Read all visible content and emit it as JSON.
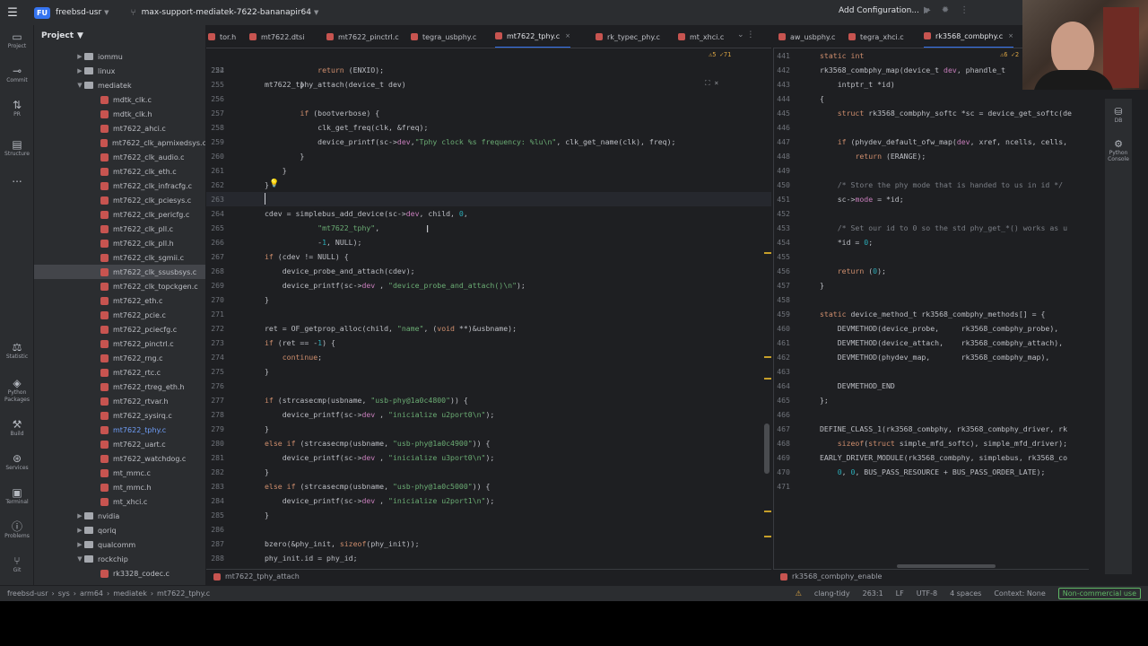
{
  "topbar": {
    "project_badge": "FU",
    "project_name": "freebsd-usr",
    "branch": "max-support-mediatek-7622-bananapir64",
    "run_config": "Add Configuration..."
  },
  "leftstrip": {
    "project": "Project",
    "commit": "Commit",
    "pr": "PR",
    "structure": "Structure",
    "more": "...",
    "statistic": "Statistic",
    "python_packages": "Python Packages",
    "build": "Build",
    "services": "Services",
    "terminal": "Terminal",
    "problems": "Problems",
    "git": "Git"
  },
  "project_panel": {
    "title": "Project",
    "rows": [
      {
        "label": "iommu",
        "type": "folder",
        "level": 1,
        "collapsed": true
      },
      {
        "label": "linux",
        "type": "folder",
        "level": 1,
        "collapsed": true
      },
      {
        "label": "mediatek",
        "type": "folder",
        "level": 1,
        "collapsed": false
      },
      {
        "label": "mdtk_clk.c",
        "type": "file",
        "level": 2
      },
      {
        "label": "mdtk_clk.h",
        "type": "file",
        "level": 2
      },
      {
        "label": "mt7622_ahci.c",
        "type": "file",
        "level": 2
      },
      {
        "label": "mt7622_clk_apmixedsys.c",
        "type": "file",
        "level": 2
      },
      {
        "label": "mt7622_clk_audio.c",
        "type": "file",
        "level": 2
      },
      {
        "label": "mt7622_clk_eth.c",
        "type": "file",
        "level": 2
      },
      {
        "label": "mt7622_clk_infracfg.c",
        "type": "file",
        "level": 2
      },
      {
        "label": "mt7622_clk_pciesys.c",
        "type": "file",
        "level": 2
      },
      {
        "label": "mt7622_clk_pericfg.c",
        "type": "file",
        "level": 2
      },
      {
        "label": "mt7622_clk_pll.c",
        "type": "file",
        "level": 2
      },
      {
        "label": "mt7622_clk_pll.h",
        "type": "file",
        "level": 2
      },
      {
        "label": "mt7622_clk_sgmii.c",
        "type": "file",
        "level": 2
      },
      {
        "label": "mt7622_clk_ssusbsys.c",
        "type": "file",
        "level": 2,
        "selected": true
      },
      {
        "label": "mt7622_clk_topckgen.c",
        "type": "file",
        "level": 2
      },
      {
        "label": "mt7622_eth.c",
        "type": "file",
        "level": 2
      },
      {
        "label": "mt7622_pcie.c",
        "type": "file",
        "level": 2
      },
      {
        "label": "mt7622_pciecfg.c",
        "type": "file",
        "level": 2
      },
      {
        "label": "mt7622_pinctrl.c",
        "type": "file",
        "level": 2
      },
      {
        "label": "mt7622_rng.c",
        "type": "file",
        "level": 2
      },
      {
        "label": "mt7622_rtc.c",
        "type": "file",
        "level": 2
      },
      {
        "label": "mt7622_rtreg_eth.h",
        "type": "file",
        "level": 2
      },
      {
        "label": "mt7622_rtvar.h",
        "type": "file",
        "level": 2
      },
      {
        "label": "mt7622_sysirq.c",
        "type": "file",
        "level": 2
      },
      {
        "label": "mt7622_tphy.c",
        "type": "file",
        "level": 2,
        "modified": true
      },
      {
        "label": "mt7622_uart.c",
        "type": "file",
        "level": 2
      },
      {
        "label": "mt7622_watchdog.c",
        "type": "file",
        "level": 2
      },
      {
        "label": "mt_mmc.c",
        "type": "file",
        "level": 2
      },
      {
        "label": "mt_mmc.h",
        "type": "file",
        "level": 2
      },
      {
        "label": "mt_xhci.c",
        "type": "file",
        "level": 2
      },
      {
        "label": "nvidia",
        "type": "folder",
        "level": 1,
        "collapsed": true
      },
      {
        "label": "qoriq",
        "type": "folder",
        "level": 1,
        "collapsed": true
      },
      {
        "label": "qualcomm",
        "type": "folder",
        "level": 1,
        "collapsed": true
      },
      {
        "label": "rockchip",
        "type": "folder",
        "level": 1,
        "collapsed": false
      },
      {
        "label": "rk3328_codec.c",
        "type": "file",
        "level": 2
      }
    ]
  },
  "tabs_left": [
    {
      "label": "tor.h",
      "active": false
    },
    {
      "label": "mt7622.dtsi",
      "active": false
    },
    {
      "label": "mt7622_pinctrl.c",
      "active": false
    },
    {
      "label": "tegra_usbphy.c",
      "active": false
    },
    {
      "label": "mt7622_tphy.c",
      "active": true
    },
    {
      "label": "rk_typec_phy.c",
      "active": false
    },
    {
      "label": "mt_xhci.c",
      "active": false
    }
  ],
  "tabs_right": [
    {
      "label": "aw_usbphy.c",
      "active": false
    },
    {
      "label": "tegra_xhci.c",
      "active": false
    },
    {
      "label": "rk3568_combphy.c",
      "active": true
    }
  ],
  "editor_left": {
    "sticky": "mt7622_tphy_attach(device_t dev)",
    "inspection": "⚠5  ✓71",
    "lines": [
      {
        "n": "254",
        "code": "\t\t\treturn (ENXIO);"
      },
      {
        "n": "255",
        "code": "\t\t}"
      },
      {
        "n": "256",
        "code": ""
      },
      {
        "n": "257",
        "code": "\t\tif (bootverbose) {"
      },
      {
        "n": "258",
        "code": "\t\t\tclk_get_freq(clk, &freq);"
      },
      {
        "n": "259",
        "code": "\t\t\tdevice_printf(sc->dev,\"Tphy clock %s frequency: %lu\\n\", clk_get_name(clk), freq);"
      },
      {
        "n": "260",
        "code": "\t\t}"
      },
      {
        "n": "261",
        "code": "\t}"
      },
      {
        "n": "262",
        "code": "}"
      },
      {
        "n": "263",
        "code": ""
      },
      {
        "n": "264",
        "code": "cdev = simplebus_add_device(sc->dev, child, 0,"
      },
      {
        "n": "265",
        "code": "\t\t\t\"mt7622_tphy\","
      },
      {
        "n": "266",
        "code": "\t\t\t-1, NULL);"
      },
      {
        "n": "267",
        "code": "if (cdev != NULL) {"
      },
      {
        "n": "268",
        "code": "\tdevice_probe_and_attach(cdev);"
      },
      {
        "n": "269",
        "code": "\tdevice_printf(sc->dev , \"device_probe_and_attach()\\n\");"
      },
      {
        "n": "270",
        "code": "}"
      },
      {
        "n": "271",
        "code": ""
      },
      {
        "n": "272",
        "code": "ret = OF_getprop_alloc(child, \"name\", (void **)&usbname);"
      },
      {
        "n": "273",
        "code": "if (ret == -1) {"
      },
      {
        "n": "274",
        "code": "\tcontinue;"
      },
      {
        "n": "275",
        "code": "}"
      },
      {
        "n": "276",
        "code": ""
      },
      {
        "n": "277",
        "code": "if (strcasecmp(usbname, \"usb-phy@1a0c4800\")) {"
      },
      {
        "n": "278",
        "code": "\tdevice_printf(sc->dev , \"inicialize u2port0\\n\");"
      },
      {
        "n": "279",
        "code": "}"
      },
      {
        "n": "280",
        "code": "else if (strcasecmp(usbname, \"usb-phy@1a0c4900\")) {"
      },
      {
        "n": "281",
        "code": "\tdevice_printf(sc->dev , \"inicialize u3port0\\n\");"
      },
      {
        "n": "282",
        "code": "}"
      },
      {
        "n": "283",
        "code": "else if (strcasecmp(usbname, \"usb-phy@1a0c5000\")) {"
      },
      {
        "n": "284",
        "code": "\tdevice_printf(sc->dev , \"inicialize u2port1\\n\");"
      },
      {
        "n": "285",
        "code": "}"
      },
      {
        "n": "286",
        "code": ""
      },
      {
        "n": "287",
        "code": "bzero(&phy_init, sizeof(phy_init));"
      },
      {
        "n": "288",
        "code": "phy_init.id = phy_id;"
      }
    ],
    "status_fn": "mt7622_tphy_attach"
  },
  "editor_right": {
    "inspection": "⚠6  ✓2",
    "lines": [
      {
        "n": "441",
        "code": "static int"
      },
      {
        "n": "442",
        "code": "rk3568_combphy_map(device_t dev, phandle_t"
      },
      {
        "n": "443",
        "code": "    intptr_t *id)"
      },
      {
        "n": "444",
        "code": "{"
      },
      {
        "n": "445",
        "code": "    struct rk3568_combphy_softc *sc = device_get_softc(de"
      },
      {
        "n": "446",
        "code": ""
      },
      {
        "n": "447",
        "code": "    if (phydev_default_ofw_map(dev, xref, ncells, cells,"
      },
      {
        "n": "448",
        "code": "        return (ERANGE);"
      },
      {
        "n": "449",
        "code": ""
      },
      {
        "n": "450",
        "code": "    /* Store the phy mode that is handed to us in id */"
      },
      {
        "n": "451",
        "code": "    sc->mode = *id;"
      },
      {
        "n": "452",
        "code": ""
      },
      {
        "n": "453",
        "code": "    /* Set our id to 0 so the std phy_get_*() works as u"
      },
      {
        "n": "454",
        "code": "    *id = 0;"
      },
      {
        "n": "455",
        "code": ""
      },
      {
        "n": "456",
        "code": "    return (0);"
      },
      {
        "n": "457",
        "code": "}"
      },
      {
        "n": "458",
        "code": ""
      },
      {
        "n": "459",
        "code": "static device_method_t rk3568_combphy_methods[] = {"
      },
      {
        "n": "460",
        "code": "    DEVMETHOD(device_probe,     rk3568_combphy_probe),"
      },
      {
        "n": "461",
        "code": "    DEVMETHOD(device_attach,    rk3568_combphy_attach),"
      },
      {
        "n": "462",
        "code": "    DEVMETHOD(phydev_map,       rk3568_combphy_map),"
      },
      {
        "n": "463",
        "code": ""
      },
      {
        "n": "464",
        "code": "    DEVMETHOD_END"
      },
      {
        "n": "465",
        "code": "};"
      },
      {
        "n": "466",
        "code": ""
      },
      {
        "n": "467",
        "code": "DEFINE_CLASS_1(rk3568_combphy, rk3568_combphy_driver, rk"
      },
      {
        "n": "468",
        "code": "    sizeof(struct simple_mfd_softc), simple_mfd_driver);"
      },
      {
        "n": "469",
        "code": "EARLY_DRIVER_MODULE(rk3568_combphy, simplebus, rk3568_co"
      },
      {
        "n": "470",
        "code": "    0, 0, BUS_PASS_RESOURCE + BUS_PASS_ORDER_LATE);"
      },
      {
        "n": "471",
        "code": ""
      }
    ],
    "status_fn": "rk3568_combphy_enable"
  },
  "rightstrip": {
    "db": "DB",
    "python_console": "Python Console"
  },
  "statusbar": {
    "crumbs": [
      "freebsd-usr",
      "sys",
      "arm64",
      "mediatek",
      "mt7622_tphy.c"
    ],
    "linter": "clang-tidy",
    "position": "263:1",
    "line_sep": "LF",
    "encoding": "UTF-8",
    "indent": "4 spaces",
    "context": "Context: None",
    "license": "Non-commercial use"
  },
  "colors": {
    "accent": "#3574f0",
    "bg": "#1e1f22",
    "panel": "#2b2d30",
    "keyword": "#cf8e6d",
    "string": "#6aab73"
  }
}
